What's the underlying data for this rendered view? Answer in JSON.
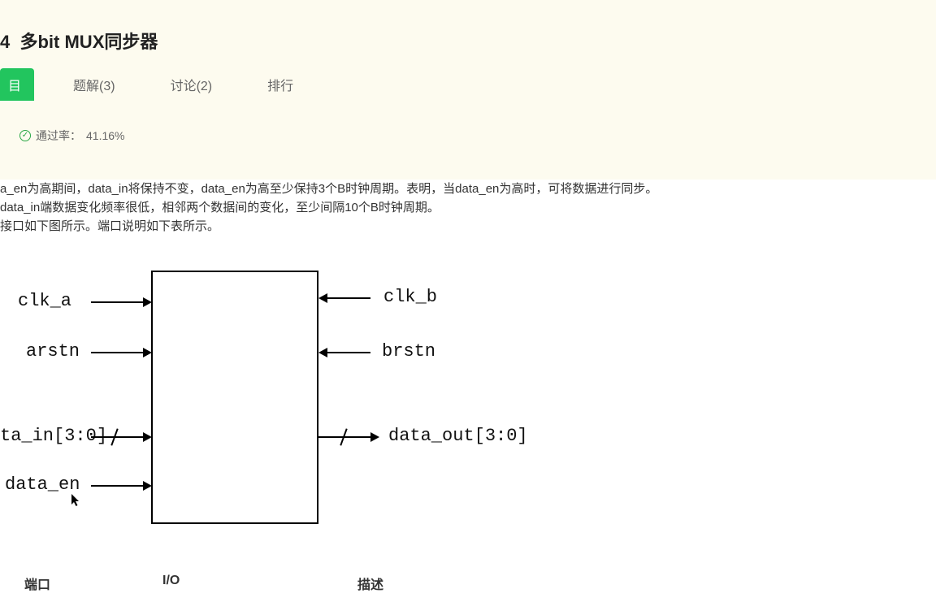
{
  "title_prefix": "4",
  "title": "多bit MUX同步器",
  "tabs": {
    "problem": "目",
    "solution": "题解(3)",
    "discuss": "讨论(2)",
    "rank": "排行"
  },
  "pass_label": "通过率：",
  "pass_value": "41.16%",
  "description": {
    "line1": "a_en为高期间，data_in将保持不变，data_en为高至少保持3个B时钟周期。表明，当data_en为高时，可将数据进行同步。",
    "line2": "data_in端数据变化频率很低，相邻两个数据间的变化，至少间隔10个B时钟周期。",
    "line3": "接口如下图所示。端口说明如下表所示。"
  },
  "signals": {
    "clk_a": "clk_a",
    "arstn": "arstn",
    "data_in": "ta_in[3:0]",
    "data_en": "data_en",
    "clk_b": "clk_b",
    "brstn": "brstn",
    "data_out": "data_out[3:0]"
  },
  "table_headers": {
    "port": "端口",
    "io": "I/O",
    "desc": "描述"
  }
}
